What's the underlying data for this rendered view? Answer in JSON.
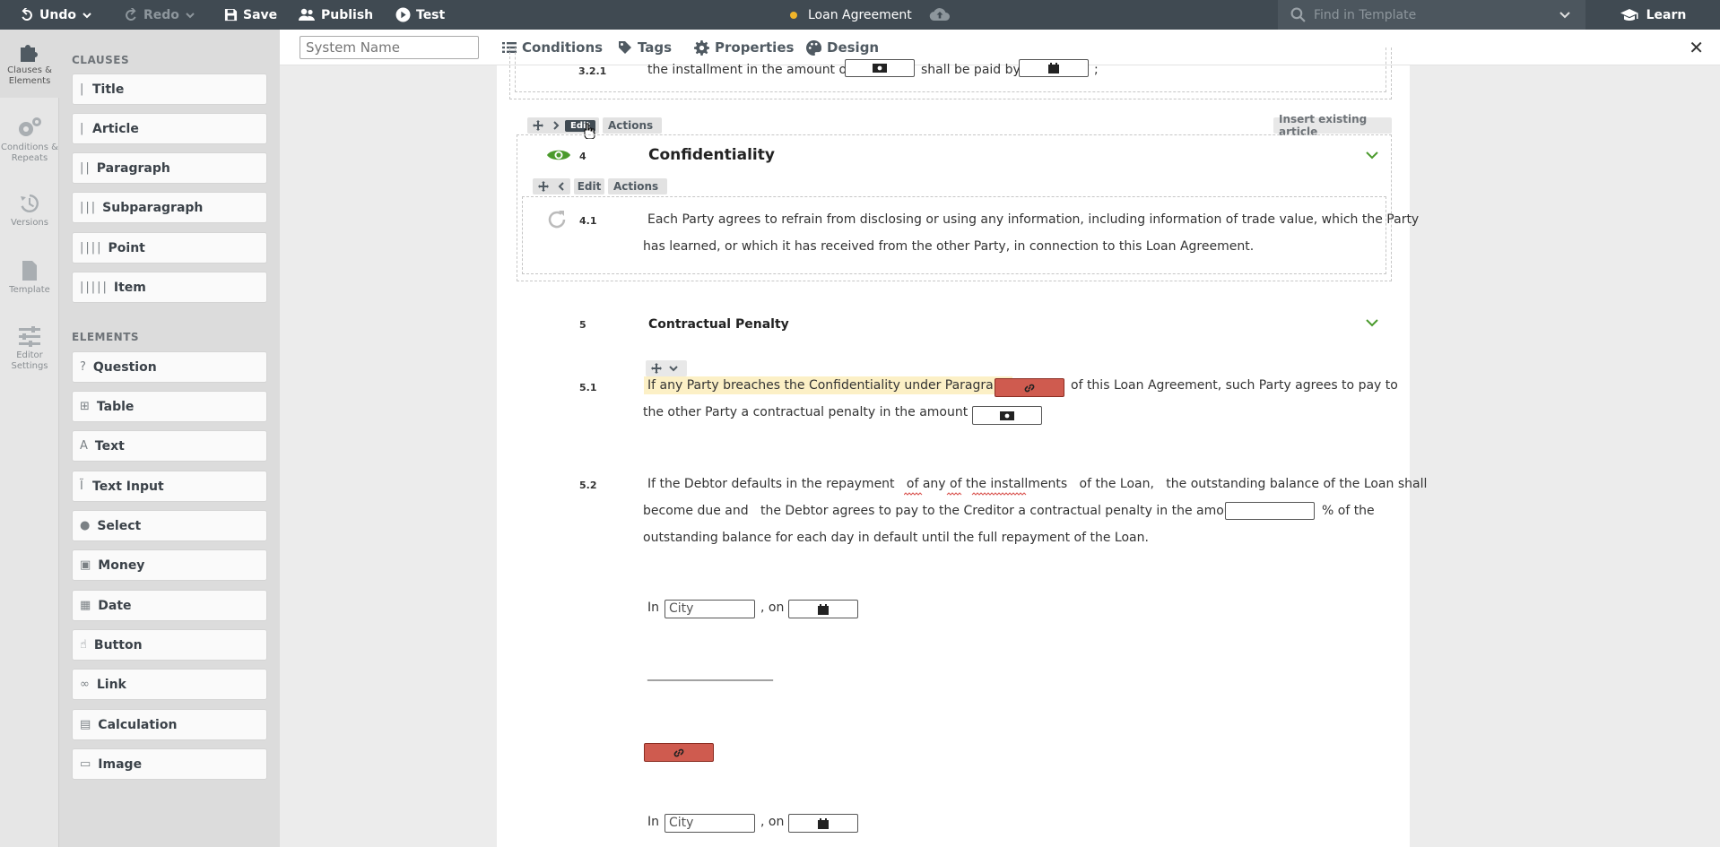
{
  "topbar": {
    "undo": "Undo",
    "redo": "Redo",
    "save": "Save",
    "publish": "Publish",
    "test": "Test",
    "doc_title": "Loan Agreement",
    "search_placeholder": "Find in Template",
    "learn": "Learn"
  },
  "rail": [
    {
      "label": "Clauses & Elements"
    },
    {
      "label": "Conditions & Repeats"
    },
    {
      "label": "Versions"
    },
    {
      "label": "Template"
    },
    {
      "label": "Editor Settings"
    }
  ],
  "palette": {
    "clauses_heading": "CLAUSES",
    "clauses": [
      "Title",
      "Article",
      "Paragraph",
      "Subparagraph",
      "Point",
      "Item"
    ],
    "elements_heading": "ELEMENTS",
    "elements": [
      "Question",
      "Table",
      "Text",
      "Text Input",
      "Select",
      "Money",
      "Date",
      "Button",
      "Link",
      "Calculation",
      "Image"
    ]
  },
  "toolbar2": {
    "system_name_placeholder": "System Name",
    "conditions": "Conditions",
    "tags": "Tags",
    "properties": "Properties",
    "design": "Design",
    "close": "✕"
  },
  "doc": {
    "p321_num": "3.2.1",
    "p321_a": "the installment in the amount of",
    "p321_b": "shall be paid by",
    "p321_c": ";",
    "art_controls": {
      "edit": "Edit",
      "actions": "Actions",
      "insert_existing": "Insert existing article"
    },
    "a4_num": "4",
    "a4_title": "Confidentiality",
    "p_controls": {
      "edit": "Edit",
      "actions": "Actions"
    },
    "p41_num": "4.1",
    "p41_line1": "Each Party agrees to refrain from disclosing or using any information, including information of trade value, which the Party",
    "p41_line2": "has learned, or which it has received from the other Party, in connection to this Loan Agreement.",
    "a5_num": "5",
    "a5_title": "Contractual Penalty",
    "p51_num": "5.1",
    "p51_highlight": "If any Party breaches the Confidentiality under Paragraph",
    "p51_a": "of this Loan Agreement, such Party agrees to pay to",
    "p51_b": "the other Party a contractual penalty in the amount of",
    "p52_num": "5.2",
    "p52_line1": "If the Debtor defaults in the repayment   of any of the installments   of the Loan,   the outstanding balance of the Loan shall",
    "p52_line2a": "become due and   the Debtor agrees to pay to the Creditor a contractual penalty in the amount of",
    "p52_line2b": "% of the",
    "p52_line3": "outstanding balance for each day in default until the full repayment of the Loan.",
    "sig1_in": "In",
    "sig1_city": "City",
    "sig1_on": ", on",
    "sig_line": "____________________",
    "sig2_in": "In",
    "sig2_city": "City",
    "sig2_on": ", on"
  }
}
